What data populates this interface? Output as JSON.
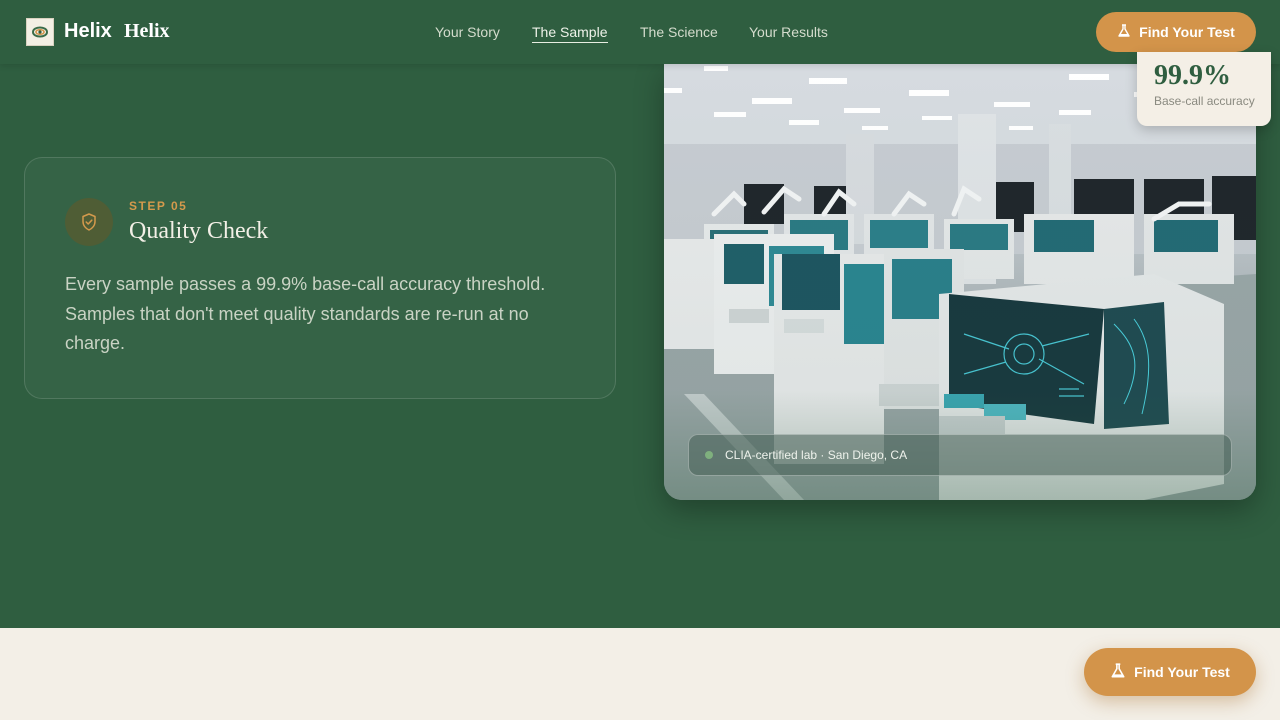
{
  "header": {
    "brand": "Helix",
    "brand_secondary": "Helix",
    "nav": [
      {
        "label": "Your Story"
      },
      {
        "label": "The Sample"
      },
      {
        "label": "The Science"
      },
      {
        "label": "Your Results"
      }
    ],
    "active_nav": "The Sample",
    "cta_label": "Find Your Test"
  },
  "step": {
    "label": "STEP 05",
    "title": "Quality Check",
    "body": "Every sample passes a 99.9% base-call accuracy threshold. Samples that don't meet quality standards are re-run at no charge.",
    "icon": "shield-check-icon"
  },
  "stat_badge": {
    "value": "99.9%",
    "label": "Base-call accuracy"
  },
  "image_caption": {
    "text": "CLIA-certified lab · San Diego, CA"
  },
  "floating_cta": {
    "label": "Find Your Test"
  },
  "colors": {
    "primary_green": "#2f5e40",
    "accent_orange": "#d3944a",
    "cream": "#f3efe7"
  }
}
